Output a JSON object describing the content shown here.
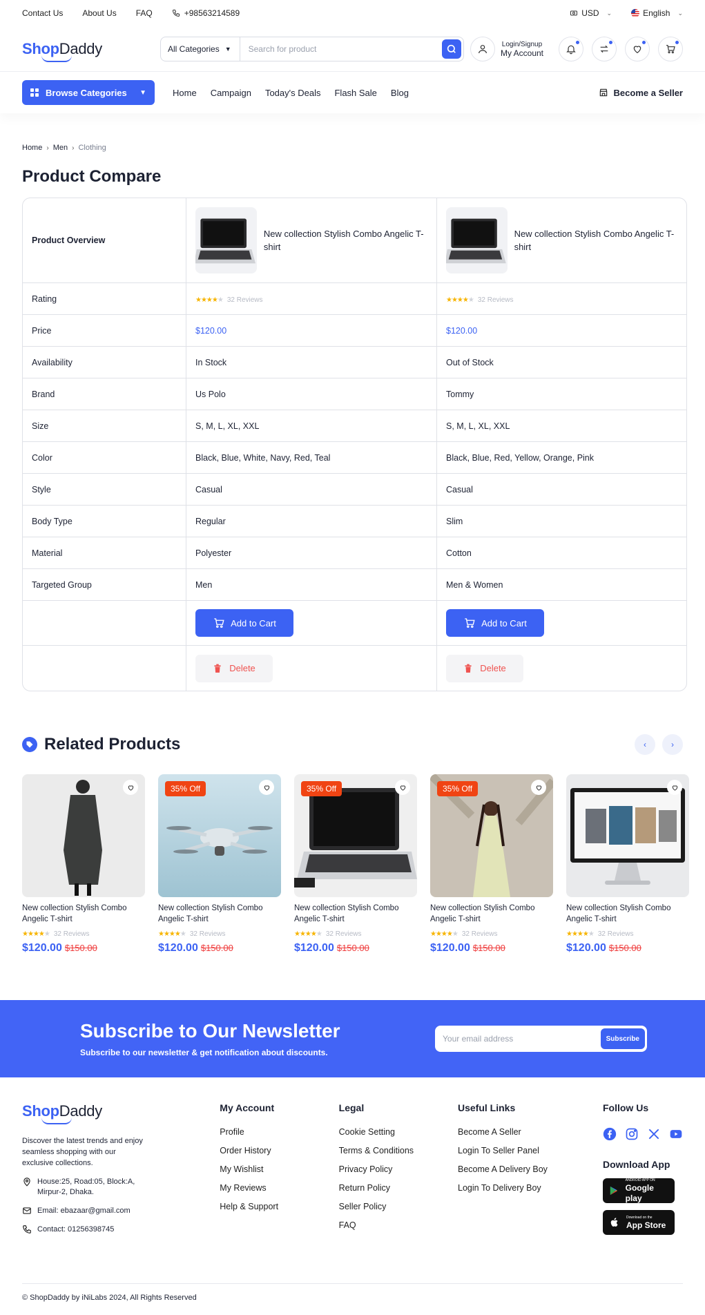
{
  "topbar": {
    "links": [
      "Contact Us",
      "About Us",
      "FAQ"
    ],
    "phone": "+98563214589",
    "currency": "USD",
    "language": "English"
  },
  "header": {
    "logo_shop": "Shop",
    "logo_daddy": "Daddy",
    "category_select": "All Categories",
    "search_placeholder": "Search for product",
    "account_line1": "Login/Signup",
    "account_line2": "My Account"
  },
  "nav": {
    "browse": "Browse Categories",
    "items": [
      "Home",
      "Campaign",
      "Today's Deals",
      "Flash Sale",
      "Blog"
    ],
    "seller": "Become a Seller"
  },
  "breadcrumb": [
    "Home",
    "Men",
    "Clothing"
  ],
  "page_title": "Product Compare",
  "compare": {
    "overview_label": "Product Overview",
    "products": [
      {
        "name": "New collection Stylish Combo Angelic T-shirt",
        "reviews": "32 Reviews",
        "rating": 4
      },
      {
        "name": "New collection Stylish Combo Angelic T-shirt",
        "reviews": "32 Reviews",
        "rating": 4
      }
    ],
    "rows": [
      {
        "label": "Price",
        "values": [
          "$120.00",
          "$120.00"
        ]
      },
      {
        "label": "Availability",
        "values": [
          "In Stock",
          "Out of Stock"
        ]
      },
      {
        "label": "Brand",
        "values": [
          "Us Polo",
          "Tommy"
        ]
      },
      {
        "label": "Size",
        "values": [
          "S, M, L, XL, XXL",
          "S, M, L, XL, XXL"
        ]
      },
      {
        "label": "Color",
        "values": [
          "Black, Blue, White, Navy, Red, Teal",
          "Black, Blue, Red, Yellow, Orange, Pink"
        ]
      },
      {
        "label": "Style",
        "values": [
          "Casual",
          "Casual"
        ]
      },
      {
        "label": "Body Type",
        "values": [
          "Regular",
          "Slim"
        ]
      },
      {
        "label": "Material",
        "values": [
          "Polyester",
          "Cotton"
        ]
      },
      {
        "label": "Targeted Group",
        "values": [
          "Men",
          "Men & Women"
        ]
      }
    ],
    "rating_label": "Rating",
    "add_to_cart": "Add to Cart",
    "delete": "Delete"
  },
  "related": {
    "title": "Related Products",
    "products": [
      {
        "badge": "",
        "name": "New collection Stylish Combo Angelic T-shirt",
        "reviews": "32 Reviews",
        "price": "$120.00",
        "old_price": "$150.00",
        "image": "coat"
      },
      {
        "badge": "35% Off",
        "name": "New collection Stylish Combo Angelic T-shirt",
        "reviews": "32 Reviews",
        "price": "$120.00",
        "old_price": "$150.00",
        "image": "drone"
      },
      {
        "badge": "35% Off",
        "name": "New collection Stylish Combo Angelic T-shirt",
        "reviews": "32 Reviews",
        "price": "$120.00",
        "old_price": "$150.00",
        "image": "laptop"
      },
      {
        "badge": "35% Off",
        "name": "New collection Stylish Combo Angelic T-shirt",
        "reviews": "32 Reviews",
        "price": "$120.00",
        "old_price": "$150.00",
        "image": "woman"
      },
      {
        "badge": "",
        "name": "New collection Stylish Combo Angelic T-shirt",
        "reviews": "32 Reviews",
        "price": "$120.00",
        "old_price": "$150.00",
        "image": "monitor"
      }
    ]
  },
  "newsletter": {
    "title": "Subscribe to Our Newsletter",
    "subtitle": "Subscribe to our newsletter & get notification about discounts.",
    "placeholder": "Your email address",
    "button": "Subscribe"
  },
  "footer": {
    "about": "Discover the latest trends and enjoy seamless shopping with our exclusive collections.",
    "address": "House:25, Road:05, Block:A, Mirpur-2, Dhaka.",
    "email": "Email: ebazaar@gmail.com",
    "contact": "Contact: 01256398745",
    "my_account": {
      "title": "My Account",
      "links": [
        "Profile",
        "Order History",
        "My Wishlist",
        "My Reviews",
        "Help & Support"
      ]
    },
    "legal": {
      "title": "Legal",
      "links": [
        "Cookie Setting",
        "Terms & Conditions",
        "Privacy Policy",
        "Return Policy",
        "Seller Policy",
        "FAQ"
      ]
    },
    "useful": {
      "title": "Useful Links",
      "links": [
        "Become A Seller",
        "Login To Seller Panel",
        "Become A Delivery Boy",
        "Login To Delivery Boy"
      ]
    },
    "follow_title": "Follow Us",
    "download_title": "Download App",
    "google_small": "ANDROID APP ON",
    "google_big": "Google play",
    "apple_small": "Download on the",
    "apple_big": "App Store",
    "copyright": "© ShopDaddy by iNiLabs 2024, All Rights Reserved"
  },
  "colors": {
    "accent": "#3c62f3",
    "badge": "#f04413",
    "old_price": "#ef3d3d",
    "newsletter_bg": "#4264f6"
  }
}
